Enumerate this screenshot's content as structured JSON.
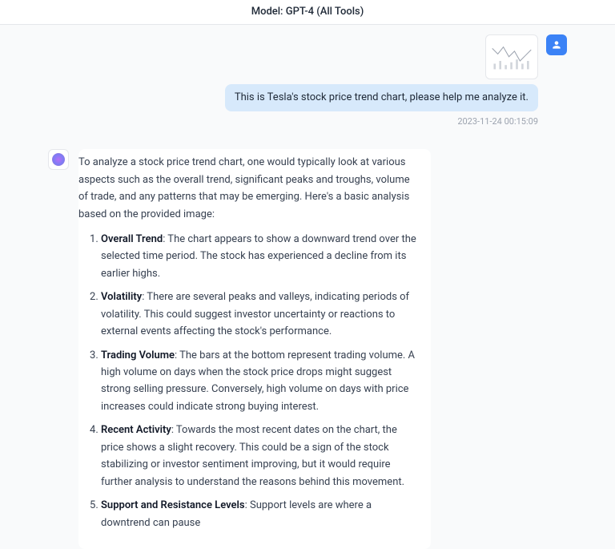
{
  "header": {
    "title": "Model: GPT-4 (All Tools)"
  },
  "user_message": {
    "text": "This is Tesla's stock price trend chart, please help me analyze it.",
    "timestamp": "2023-11-24 00:15:09",
    "attachment_alt": "stock-chart-thumbnail"
  },
  "assistant_message": {
    "intro": "To analyze a stock price trend chart, one would typically look at various aspects such as the overall trend, significant peaks and troughs, volume of trade, and any patterns that may be emerging. Here's a basic analysis based on the provided image:",
    "points": [
      {
        "title": "Overall Trend",
        "body": ": The chart appears to show a downward trend over the selected time period. The stock has experienced a decline from its earlier highs."
      },
      {
        "title": "Volatility",
        "body": ": There are several peaks and valleys, indicating periods of volatility. This could suggest investor uncertainty or reactions to external events affecting the stock's performance."
      },
      {
        "title": "Trading Volume",
        "body": ": The bars at the bottom represent trading volume. A high volume on days when the stock price drops might suggest strong selling pressure. Conversely, high volume on days with price increases could indicate strong buying interest."
      },
      {
        "title": "Recent Activity",
        "body": ": Towards the most recent dates on the chart, the price shows a slight recovery. This could be a sign of the stock stabilizing or investor sentiment improving, but it would require further analysis to understand the reasons behind this movement."
      },
      {
        "title": "Support and Resistance Levels",
        "body": ": Support levels are where a downtrend can pause"
      }
    ]
  }
}
